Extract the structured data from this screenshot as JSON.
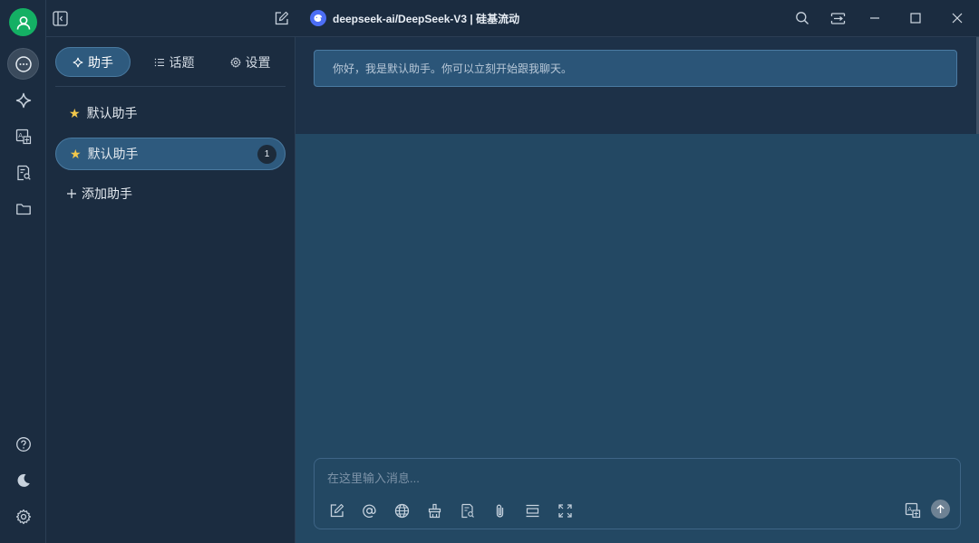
{
  "topbar": {
    "model_title": "deepseek-ai/DeepSeek-V3 | 硅基流动"
  },
  "tabs": [
    {
      "label": "助手",
      "icon": "sparkle-icon",
      "active": true
    },
    {
      "label": "话题",
      "icon": "list-icon",
      "active": false
    },
    {
      "label": "设置",
      "icon": "gear-icon",
      "active": false
    }
  ],
  "assistants": [
    {
      "name": "默认助手",
      "selected": false
    },
    {
      "name": "默认助手",
      "selected": true,
      "badge": "1"
    }
  ],
  "add_assistant_label": "添加助手",
  "chat": {
    "welcome_message": "你好，我是默认助手。你可以立刻开始跟我聊天。",
    "input_placeholder": "在这里输入消息...",
    "input_value": ""
  },
  "colors": {
    "accent": "#2e5a7e",
    "avatar": "#14b064",
    "star": "#f2c84b",
    "background": "#1b2c40",
    "chat_background": "#234863"
  }
}
